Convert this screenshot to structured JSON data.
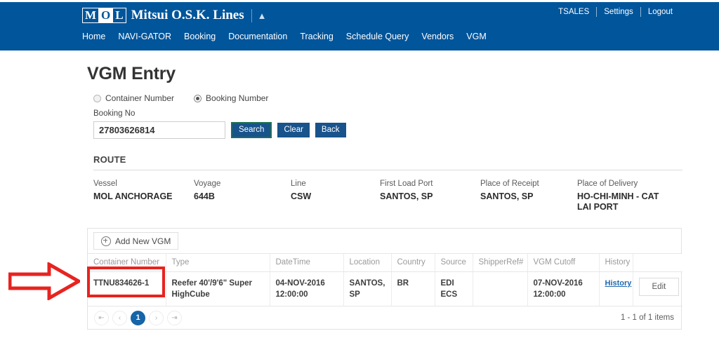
{
  "header": {
    "logo": {
      "letters": [
        "M",
        "O",
        "L"
      ],
      "wordmark": "Mitsui O.S.K. Lines",
      "caret_icon": "chevron-up-icon"
    },
    "top_links": [
      {
        "label": "TSALES"
      },
      {
        "label": "Settings"
      },
      {
        "label": "Logout"
      }
    ],
    "nav_items": [
      {
        "label": "Home"
      },
      {
        "label": "NAVI-GATOR"
      },
      {
        "label": "Booking"
      },
      {
        "label": "Documentation"
      },
      {
        "label": "Tracking"
      },
      {
        "label": "Schedule Query"
      },
      {
        "label": "Vendors"
      },
      {
        "label": "VGM"
      }
    ],
    "bar_color": "#00559b"
  },
  "main": {
    "title": "VGM Entry",
    "search_mode": {
      "options": [
        {
          "label": "Container Number",
          "selected": false
        },
        {
          "label": "Booking Number",
          "selected": true
        }
      ]
    },
    "booking_field": {
      "label": "Booking No",
      "value": "27803626814",
      "placeholder": ""
    },
    "buttons": {
      "search": "Search",
      "clear": "Clear",
      "back": "Back"
    }
  },
  "route": {
    "heading": "ROUTE",
    "fields": [
      {
        "label": "Vessel",
        "value": "MOL ANCHORAGE"
      },
      {
        "label": "Voyage",
        "value": "644B"
      },
      {
        "label": "Line",
        "value": "CSW"
      },
      {
        "label": "First Load Port",
        "value": "SANTOS, SP"
      },
      {
        "label": "Place of Receipt",
        "value": "SANTOS, SP"
      },
      {
        "label": "Place of Delivery",
        "value": "HO-CHI-MINH - CAT LAI PORT"
      }
    ]
  },
  "grid": {
    "add_button": {
      "label": "Add New VGM",
      "icon": "plus-circle-icon"
    },
    "columns": [
      "Container Number",
      "Type",
      "DateTime",
      "Location",
      "Country",
      "Source",
      "ShipperRef#",
      "VGM Cutoff",
      "History",
      ""
    ],
    "rows": [
      {
        "container_number": "TTNU834626-1",
        "type": "Reefer 40'/9'6\" Super HighCube",
        "datetime": "04-NOV-2016 12:00:00",
        "location": "SANTOS, SP",
        "country": "BR",
        "source": "EDI ECS",
        "shipper_ref": "",
        "vgm_cutoff": "07-NOV-2016 12:00:00",
        "history_link": "History",
        "edit_label": "Edit"
      }
    ],
    "pager": {
      "first_icon": "first-page-icon",
      "prev_icon": "prev-page-icon",
      "next_icon": "next-page-icon",
      "last_icon": "last-page-icon",
      "pages": [
        "1"
      ],
      "current_page": "1",
      "info": "1 - 1 of 1 items"
    }
  },
  "annotations": {
    "arrow_color": "#e8231f",
    "highlight_color": "#e8231f"
  }
}
